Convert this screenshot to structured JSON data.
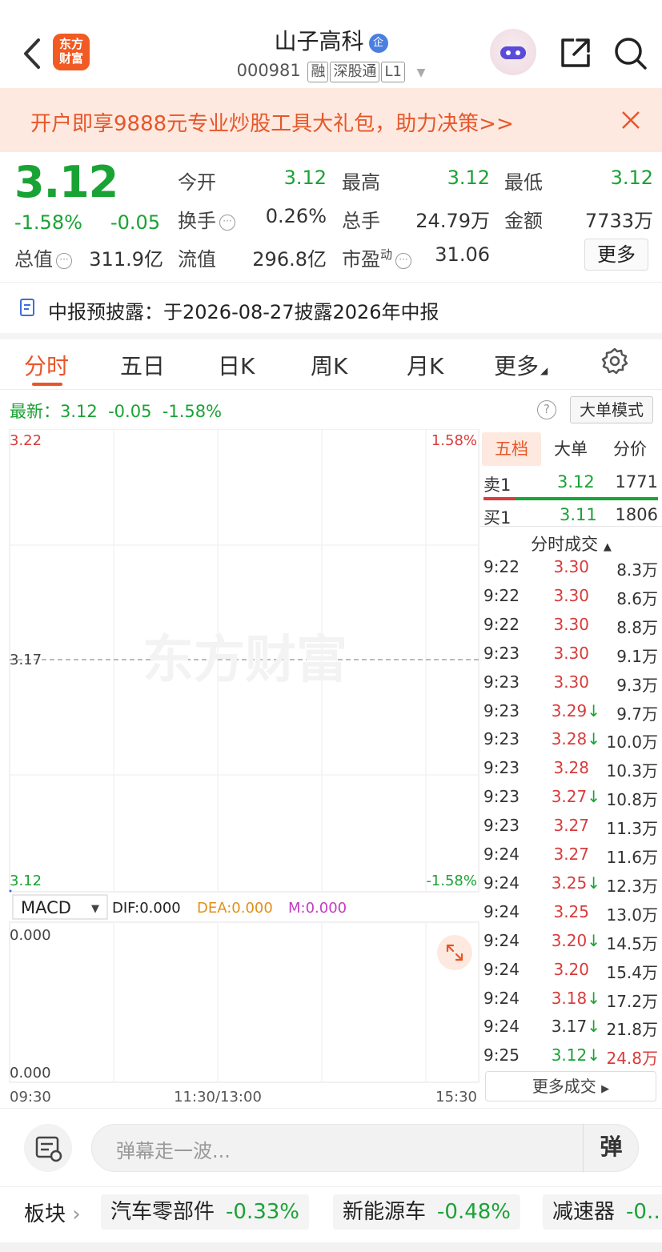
{
  "header": {
    "logo_text_line1": "东方",
    "logo_text_line2": "财富",
    "stock_name": "山子高科",
    "stock_badge": "企",
    "stock_code": "000981",
    "tags": [
      "融",
      "深股通",
      "L1"
    ]
  },
  "banner": {
    "text": "开户即享9888元专业炒股工具大礼包，助力决策>>"
  },
  "quote": {
    "price": "3.12",
    "change_pct": "-1.58%",
    "change": "-0.05",
    "fields": [
      {
        "label": "今开",
        "value": "3.12"
      },
      {
        "label": "最高",
        "value": "3.12"
      },
      {
        "label": "最低",
        "value": "3.12"
      },
      {
        "label": "换手",
        "value": "0.26%"
      },
      {
        "label": "总手",
        "value": "24.79万"
      },
      {
        "label": "金额",
        "value": "7733万"
      },
      {
        "label": "总值",
        "value": "311.9亿"
      },
      {
        "label": "流值",
        "value": "296.8亿"
      },
      {
        "label": "市盈",
        "value": "31.06"
      }
    ],
    "pe_superscript": "动",
    "more_label": "更多"
  },
  "notice": {
    "text": "中报预披露：于2026-08-27披露2026年中报"
  },
  "tabs": [
    "分时",
    "五日",
    "日K",
    "周K",
    "月K",
    "更多"
  ],
  "latest": {
    "text": "最新：3.12  -0.05  -1.58%",
    "help": "?",
    "mode_button": "大单模式"
  },
  "chart": {
    "price_top": "3.22",
    "pct_top": "1.58%",
    "price_mid": "3.17",
    "price_bottom": "3.12",
    "pct_bottom": "-1.58%",
    "watermark": "东方财富",
    "indicator": "MACD",
    "dif": "DIF:0.000",
    "dea": "DEA:0.000",
    "m": "M:0.000",
    "macd_top": "0.000",
    "macd_bottom": "0.000",
    "time_start": "09:30",
    "time_mid": "11:30/13:00",
    "time_end": "15:30"
  },
  "chart_data": {
    "type": "line",
    "ylim": [
      3.12,
      3.22
    ],
    "x": [
      "09:30",
      "11:30/13:00",
      "15:30"
    ],
    "series": [
      {
        "values": [
          3.12
        ]
      }
    ],
    "grid": true,
    "title": "",
    "xlabel": "",
    "ylabel": ""
  },
  "order_book": {
    "tabs": [
      "五档",
      "大单",
      "分价"
    ],
    "sell1": {
      "label": "卖1",
      "price": "3.12",
      "volume": "1771"
    },
    "buy1": {
      "label": "买1",
      "price": "3.11",
      "volume": "1806"
    },
    "trades_title": "分时成交",
    "trades": [
      {
        "time": "9:22",
        "price": "3.30",
        "arrow": "",
        "vol": "8.3万",
        "color": "red",
        "vol_color": "dark"
      },
      {
        "time": "9:22",
        "price": "3.30",
        "arrow": "",
        "vol": "8.6万",
        "color": "red",
        "vol_color": "dark"
      },
      {
        "time": "9:22",
        "price": "3.30",
        "arrow": "",
        "vol": "8.8万",
        "color": "red",
        "vol_color": "dark"
      },
      {
        "time": "9:23",
        "price": "3.30",
        "arrow": "",
        "vol": "9.1万",
        "color": "red",
        "vol_color": "dark"
      },
      {
        "time": "9:23",
        "price": "3.30",
        "arrow": "",
        "vol": "9.3万",
        "color": "red",
        "vol_color": "dark"
      },
      {
        "time": "9:23",
        "price": "3.29",
        "arrow": "↓",
        "vol": "9.7万",
        "color": "red",
        "vol_color": "dark"
      },
      {
        "time": "9:23",
        "price": "3.28",
        "arrow": "↓",
        "vol": "10.0万",
        "color": "red",
        "vol_color": "dark"
      },
      {
        "time": "9:23",
        "price": "3.28",
        "arrow": "",
        "vol": "10.3万",
        "color": "red",
        "vol_color": "dark"
      },
      {
        "time": "9:23",
        "price": "3.27",
        "arrow": "↓",
        "vol": "10.8万",
        "color": "red",
        "vol_color": "dark"
      },
      {
        "time": "9:23",
        "price": "3.27",
        "arrow": "",
        "vol": "11.3万",
        "color": "red",
        "vol_color": "dark"
      },
      {
        "time": "9:24",
        "price": "3.27",
        "arrow": "",
        "vol": "11.6万",
        "color": "red",
        "vol_color": "dark"
      },
      {
        "time": "9:24",
        "price": "3.25",
        "arrow": "↓",
        "vol": "12.3万",
        "color": "red",
        "vol_color": "dark"
      },
      {
        "time": "9:24",
        "price": "3.25",
        "arrow": "",
        "vol": "13.0万",
        "color": "red",
        "vol_color": "dark"
      },
      {
        "time": "9:24",
        "price": "3.20",
        "arrow": "↓",
        "vol": "14.5万",
        "color": "red",
        "vol_color": "dark"
      },
      {
        "time": "9:24",
        "price": "3.20",
        "arrow": "",
        "vol": "15.4万",
        "color": "red",
        "vol_color": "dark"
      },
      {
        "time": "9:24",
        "price": "3.18",
        "arrow": "↓",
        "vol": "17.2万",
        "color": "red",
        "vol_color": "dark"
      },
      {
        "time": "9:24",
        "price": "3.17",
        "arrow": "↓",
        "vol": "21.8万",
        "color": "dark",
        "vol_color": "dark"
      },
      {
        "time": "9:25",
        "price": "3.12",
        "arrow": "↓",
        "vol": "24.8万",
        "color": "green",
        "vol_color": "red"
      }
    ],
    "more_trades": "更多成交"
  },
  "comment": {
    "placeholder": "弹幕走一波...",
    "danmu": "弹"
  },
  "sectors": {
    "label": "板块",
    "items": [
      {
        "name": "汽车零部件",
        "value": "-0.33%"
      },
      {
        "name": "新能源车",
        "value": "-0.48%"
      },
      {
        "name": "减速器",
        "value": "-0.…"
      }
    ]
  },
  "colors": {
    "down_green": "#1aa335",
    "up_red": "#d83c3c",
    "brand_orange": "#e7562a"
  }
}
